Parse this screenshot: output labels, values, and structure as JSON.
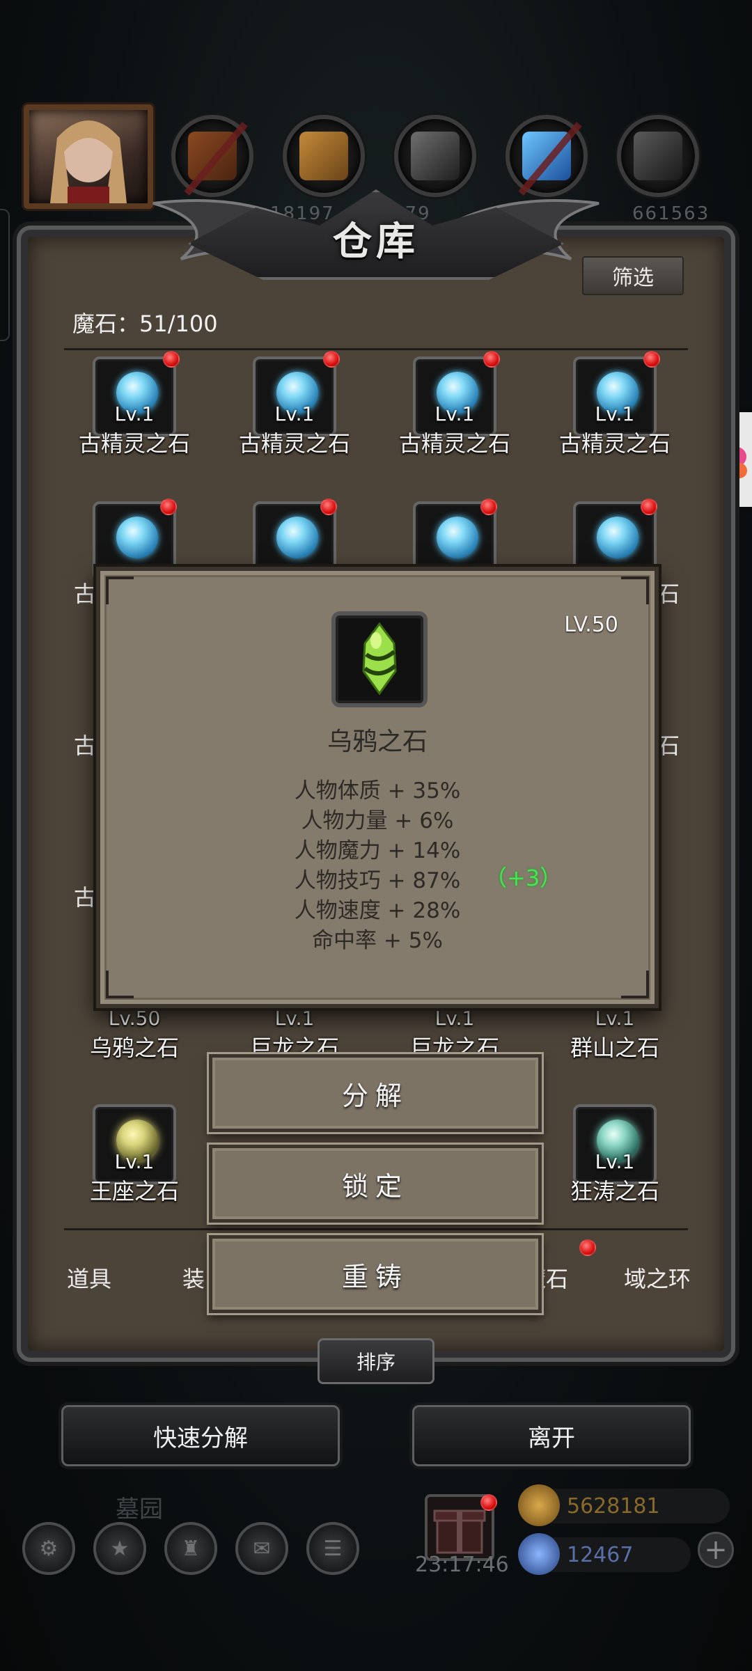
{
  "panel": {
    "title": "仓库",
    "filter_label": "筛选",
    "count_label": "魔石：51/100",
    "sort_label": "排序"
  },
  "top_numbers": [
    "18197",
    "25879",
    "661563"
  ],
  "grid": {
    "row1": [
      {
        "lv": "Lv.1",
        "name": "古精灵之石"
      },
      {
        "lv": "Lv.1",
        "name": "古精灵之石"
      },
      {
        "lv": "Lv.1",
        "name": "古精灵之石"
      },
      {
        "lv": "Lv.1",
        "name": "古精灵之石"
      }
    ],
    "row5": [
      {
        "lv": "Lv.50",
        "name": "乌鸦之石"
      },
      {
        "lv": "Lv.1",
        "name": "巨龙之石"
      },
      {
        "lv": "Lv.1",
        "name": "巨龙之石"
      },
      {
        "lv": "Lv.1",
        "name": "群山之石"
      }
    ],
    "row6": [
      {
        "lv": "Lv.1",
        "name": "王座之石"
      },
      {
        "lv": "Lv.1",
        "name": "狂涛之石"
      }
    ],
    "partial_left": "古",
    "partial_right": "石"
  },
  "tabs": [
    "道具",
    "装",
    "魔石",
    "域之环"
  ],
  "popup": {
    "level": "LV.50",
    "name": "乌鸦之石",
    "stats": [
      "人物体质 + 35%",
      "人物力量 + 6%",
      "人物魔力 + 14%",
      "人物技巧 + 87%",
      "人物速度 + 28%",
      "命中率 + 5%"
    ],
    "bonus": "（+3）"
  },
  "actions": {
    "decompose": "分解",
    "lock": "锁定",
    "recast": "重铸"
  },
  "bottom": {
    "quick_decompose": "快速分解",
    "leave": "离开"
  },
  "hud": {
    "area_name": "墓园",
    "clock": "23:17:46",
    "gold": "5628181",
    "gems": "12467"
  },
  "colors": {
    "bonus_green": "#4de05b",
    "gold_text": "#8a6a2a",
    "gem_text": "#5a6fa8"
  }
}
